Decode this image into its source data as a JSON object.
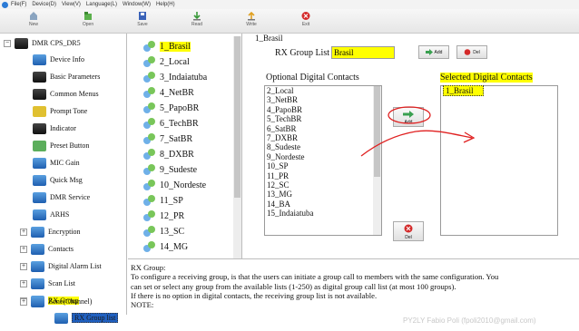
{
  "menubar": {
    "items": [
      "File(F)",
      "Device(D)",
      "View(V)",
      "Language(L)",
      "Window(W)",
      "Help(H)"
    ]
  },
  "toolbar": {
    "buttons": [
      {
        "label": "New",
        "icon": "home-icon"
      },
      {
        "label": "Open",
        "icon": "open-icon"
      },
      {
        "label": "Save",
        "icon": "save-icon"
      },
      {
        "label": "Read",
        "icon": "read-icon"
      },
      {
        "label": "Write",
        "icon": "write-icon"
      },
      {
        "label": "Exit",
        "icon": "exit-icon"
      }
    ]
  },
  "tree": {
    "root": "DMR CPS_DR5",
    "items": [
      {
        "label": "Device Info",
        "icon": "device-info-icon"
      },
      {
        "label": "Basic Parameters",
        "icon": "basic-parameters-icon"
      },
      {
        "label": "Common Menus",
        "icon": "common-menus-icon"
      },
      {
        "label": "Prompt Tone",
        "icon": "prompt-tone-icon"
      },
      {
        "label": "Indicator",
        "icon": "indicator-icon"
      },
      {
        "label": "Preset Button",
        "icon": "preset-button-icon"
      },
      {
        "label": "MIC Gain",
        "icon": "mic-gain-icon"
      },
      {
        "label": "Quick Msg",
        "icon": "quick-msg-icon"
      },
      {
        "label": "DMR Service",
        "icon": "dmr-service-icon"
      },
      {
        "label": "ARHS",
        "icon": "arhs-icon"
      },
      {
        "label": "Encryption",
        "icon": "encryption-icon"
      },
      {
        "label": "Contacts",
        "icon": "contacts-icon"
      },
      {
        "label": "Digital Alarm List",
        "icon": "digital-alarm-icon"
      },
      {
        "label": "Scan List",
        "icon": "scan-list-icon"
      },
      {
        "label": "RX Group",
        "icon": "rx-group-icon"
      },
      {
        "label": "RX Group list",
        "icon": "rx-group-list-icon"
      },
      {
        "label": "Zone(Channel)",
        "icon": "zone-icon"
      }
    ]
  },
  "groups": {
    "items": [
      "1_Brasil",
      "2_Local",
      "3_Indaiatuba",
      "4_NetBR",
      "5_PapoBR",
      "6_TechBR",
      "7_SatBR",
      "8_DXBR",
      "9_Sudeste",
      "10_Nordeste",
      "11_SP",
      "12_PR",
      "13_SC",
      "14_MG"
    ]
  },
  "detail": {
    "title": "1_Brasil",
    "rx_group_list_label": "RX Group List",
    "rx_group_name": "Brasil",
    "add_button": "Add",
    "delete_button": "Del",
    "optional_label": "Optional Digital Contacts",
    "optional_items": [
      "2_Local",
      "3_NetBR",
      "4_PapoBR",
      "5_TechBR",
      "6_SatBR",
      "7_DXBR",
      "8_Sudeste",
      "9_Nordeste",
      "10_SP",
      "11_PR",
      "12_SC",
      "13_MG",
      "14_BA",
      "15_Indaiatuba"
    ],
    "selected_label": "Selected Digital Contacts",
    "selected_items": [
      "1_Brasil"
    ],
    "move_add_label": "Add",
    "move_del_label": "Del"
  },
  "help": {
    "lines": [
      "RX Group:",
      "To configure a receiving group, is that the users can initiate a group call to members with the same configuration. You",
      "can set or select any group from the available lists (1-250) as digital group call list (at most 100 groups).",
      "If there is no option in digital contacts, the receiving group list is not available.",
      "NOTE:"
    ]
  },
  "watermark": "PY2LY Fabio Poli (fpoli2010@gmail.com)",
  "colors": {
    "highlight": "#ffff00",
    "annotation": "#e02020",
    "selection": "#2060c0"
  }
}
